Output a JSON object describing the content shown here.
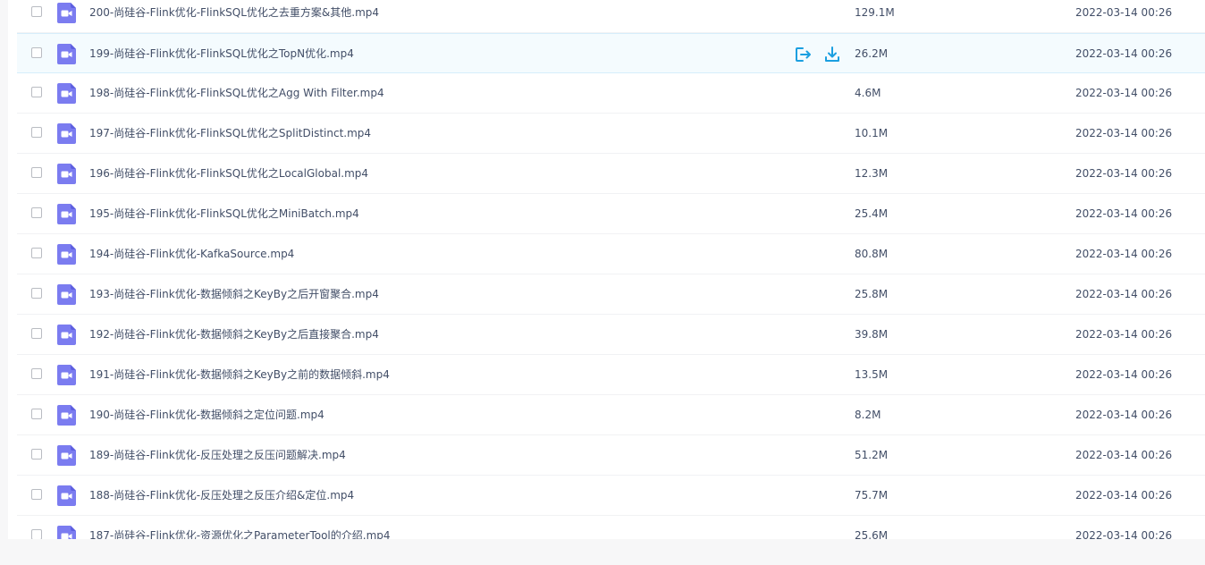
{
  "files": [
    {
      "name": "200-尚硅谷-Flink优化-FlinkSQL优化之去重方案&其他.mp4",
      "size": "129.1M",
      "date": "2022-03-14 00:26"
    },
    {
      "name": "199-尚硅谷-Flink优化-FlinkSQL优化之TopN优化.mp4",
      "size": "26.2M",
      "date": "2022-03-14 00:26",
      "hovered": true
    },
    {
      "name": "198-尚硅谷-Flink优化-FlinkSQL优化之Agg With Filter.mp4",
      "size": "4.6M",
      "date": "2022-03-14 00:26"
    },
    {
      "name": "197-尚硅谷-Flink优化-FlinkSQL优化之SplitDistinct.mp4",
      "size": "10.1M",
      "date": "2022-03-14 00:26"
    },
    {
      "name": "196-尚硅谷-Flink优化-FlinkSQL优化之LocalGlobal.mp4",
      "size": "12.3M",
      "date": "2022-03-14 00:26"
    },
    {
      "name": "195-尚硅谷-Flink优化-FlinkSQL优化之MiniBatch.mp4",
      "size": "25.4M",
      "date": "2022-03-14 00:26"
    },
    {
      "name": "194-尚硅谷-Flink优化-KafkaSource.mp4",
      "size": "80.8M",
      "date": "2022-03-14 00:26"
    },
    {
      "name": "193-尚硅谷-Flink优化-数据倾斜之KeyBy之后开窗聚合.mp4",
      "size": "25.8M",
      "date": "2022-03-14 00:26"
    },
    {
      "name": "192-尚硅谷-Flink优化-数据倾斜之KeyBy之后直接聚合.mp4",
      "size": "39.8M",
      "date": "2022-03-14 00:26"
    },
    {
      "name": "191-尚硅谷-Flink优化-数据倾斜之KeyBy之前的数据倾斜.mp4",
      "size": "13.5M",
      "date": "2022-03-14 00:26"
    },
    {
      "name": "190-尚硅谷-Flink优化-数据倾斜之定位问题.mp4",
      "size": "8.2M",
      "date": "2022-03-14 00:26"
    },
    {
      "name": "189-尚硅谷-Flink优化-反压处理之反压问题解决.mp4",
      "size": "51.2M",
      "date": "2022-03-14 00:26"
    },
    {
      "name": "188-尚硅谷-Flink优化-反压处理之反压介绍&定位.mp4",
      "size": "75.7M",
      "date": "2022-03-14 00:26"
    },
    {
      "name": "187-尚硅谷-Flink优化-资源优化之ParameterTool的介绍.mp4",
      "size": "25.6M",
      "date": "2022-03-14 00:26"
    }
  ],
  "row_actions": {
    "share_icon": "share-icon",
    "download_icon": "download-icon"
  },
  "colors": {
    "video_icon": "#7b7cf0",
    "action_icon": "#1b9fe0",
    "text": "#424e67"
  }
}
